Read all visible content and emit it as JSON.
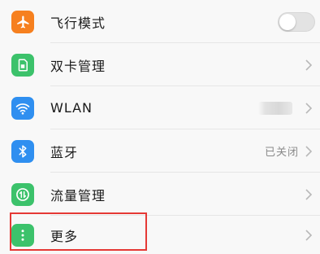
{
  "rows": [
    {
      "label": "飞行模式",
      "icon": "airplane-icon",
      "icon_color": "#f6801f"
    },
    {
      "label": "双卡管理",
      "icon": "sim-card-icon",
      "icon_color": "#3cc26b"
    },
    {
      "label": "WLAN",
      "icon": "wifi-icon",
      "icon_color": "#2f8ff0"
    },
    {
      "label": "蓝牙",
      "icon": "bluetooth-icon",
      "icon_color": "#2f8ff0",
      "status": "已关闭"
    },
    {
      "label": "流量管理",
      "icon": "data-usage-icon",
      "icon_color": "#3cc26b"
    },
    {
      "label": "更多",
      "icon": "more-icon",
      "icon_color": "#3cc26b"
    }
  ],
  "colors": {
    "highlight_border": "#e53935",
    "toggle_off": "#e3e3e3"
  }
}
